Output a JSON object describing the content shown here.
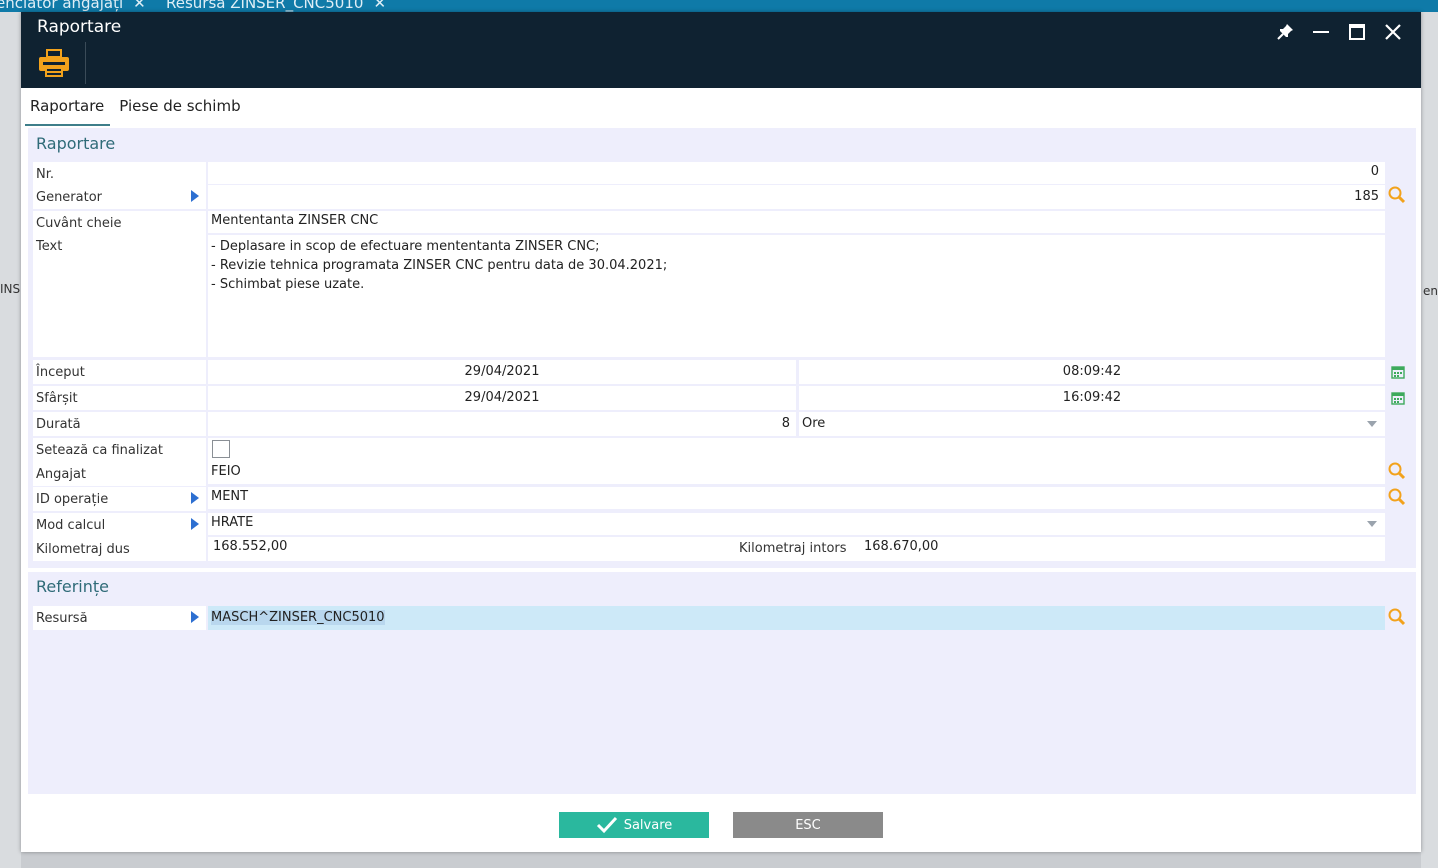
{
  "background": {
    "tabs": [
      {
        "label": "enclator angajați",
        "close": "✕"
      },
      {
        "label": "Resursă ZINSER_CNC5010",
        "close": "✕"
      }
    ],
    "left_edge_text": "INS",
    "right_edge_text": "en"
  },
  "dialog": {
    "title": "Raportare",
    "toolbar": {
      "print_icon": "printer-icon"
    },
    "window_buttons": [
      "pin-icon",
      "minimize-icon",
      "maximize-icon",
      "close-icon"
    ]
  },
  "tabs": [
    {
      "label": "Raportare",
      "active": true
    },
    {
      "label": "Piese de schimb",
      "active": false
    }
  ],
  "sections": {
    "raportare": "Raportare",
    "referinte": "Referințe"
  },
  "fields": {
    "nr": {
      "label": "Nr.",
      "value": "0"
    },
    "generator": {
      "label": "Generator",
      "value": "185"
    },
    "cuvant_cheie": {
      "label": "Cuvânt cheie",
      "value": "Mententanta ZINSER CNC"
    },
    "text": {
      "label": "Text",
      "lines": [
        "- Deplasare in scop de efectuare mententanta ZINSER CNC;",
        "- Revizie tehnica programata ZINSER CNC pentru data de 30.04.2021;",
        "- Schimbat piese uzate."
      ]
    },
    "inceput": {
      "label": "Început",
      "date": "29/04/2021",
      "time": "08:09:42"
    },
    "sfarsit": {
      "label": "Sfârșit",
      "date": "29/04/2021",
      "time": "16:09:42"
    },
    "durata": {
      "label": "Durată",
      "value": "8",
      "unit": "Ore"
    },
    "finalizat": {
      "label": "Setează ca finalizat",
      "checked": false
    },
    "angajat": {
      "label": "Angajat",
      "value": "FEIO"
    },
    "id_operatie": {
      "label": "ID operație",
      "value": "MENT"
    },
    "mod_calcul": {
      "label": "Mod calcul",
      "value": "HRATE"
    },
    "km_dus": {
      "label": "Kilometraj dus",
      "value": "168.552,00"
    },
    "km_intors": {
      "label": "Kilometraj intors",
      "value": "168.670,00"
    },
    "resursa": {
      "label": "Resursă",
      "value": "MASCH^ZINSER_CNC5010"
    }
  },
  "buttons": {
    "save": "Salvare",
    "esc": "ESC"
  },
  "colors": {
    "titlebar": "#0f2231",
    "accent_orange": "#f2a21c",
    "save_green": "#2ab89e",
    "esc_gray": "#8a8a8a",
    "panel_bg": "#eeeefc"
  }
}
